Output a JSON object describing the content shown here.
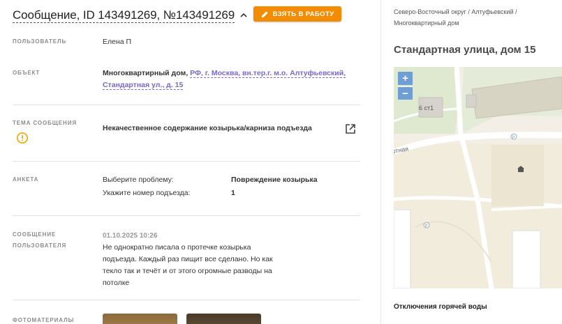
{
  "header": {
    "title": "Сообщение, ID 143491269, №143491269",
    "take_button": "ВЗЯТЬ В РАБОТУ"
  },
  "fields": {
    "user": {
      "label": "ПОЛЬЗОВАТЕЛЬ",
      "value": "Елена П"
    },
    "object": {
      "label": "ОБЪЕКТ",
      "type": "Многоквартирный дом,",
      "address": "РФ, г. Москва, вн.тер.г. м.о. Алтуфьевский, Стандартная ул., д. 15"
    },
    "topic": {
      "label": "ТЕМА СООБЩЕНИЯ",
      "value": "Некачественное содержание козырька/карниза подъезда"
    },
    "survey": {
      "label": "АНКЕТА",
      "rows": [
        {
          "question": "Выберите проблему:",
          "answer": "Повреждение козырька"
        },
        {
          "question": "Укажите номер подъезда:",
          "answer": "1"
        }
      ]
    },
    "message": {
      "label_line1": "СООБЩЕНИЕ",
      "label_line2": "ПОЛЬЗОВАТЕЛЯ",
      "date": "01.10.2025 10:26",
      "lines": [
        "Не однократно писала о протечке козырька",
        "подъезда. Каждый раз пищит все сделано. Но как",
        "текло так и течёт и от этого огромные разводы на",
        "потолке"
      ]
    },
    "photos": {
      "label": "ФОТОМАТЕРИАЛЫ"
    }
  },
  "right": {
    "breadcrumb_line1": "Северо-Восточный округ / Алтуфьевский /",
    "breadcrumb_line2": "Многоквартирный дом",
    "address_title": "Стандартная улица, дом 15",
    "map": {
      "zoom_in": "+",
      "zoom_out": "−",
      "building_label": "6 ст1",
      "street_label": "ртная",
      "parking_label": "P"
    },
    "hot_water": "Отключения горячей воды"
  },
  "colors": {
    "accent_orange": "#f28c00",
    "link_purple": "#7b68c9",
    "warn_orange": "#f2a100",
    "map_zoom_blue": "#6f9ed6"
  },
  "icons": [
    "chevron-up-icon",
    "pencil-icon",
    "warning-circle-icon",
    "external-link-icon"
  ]
}
